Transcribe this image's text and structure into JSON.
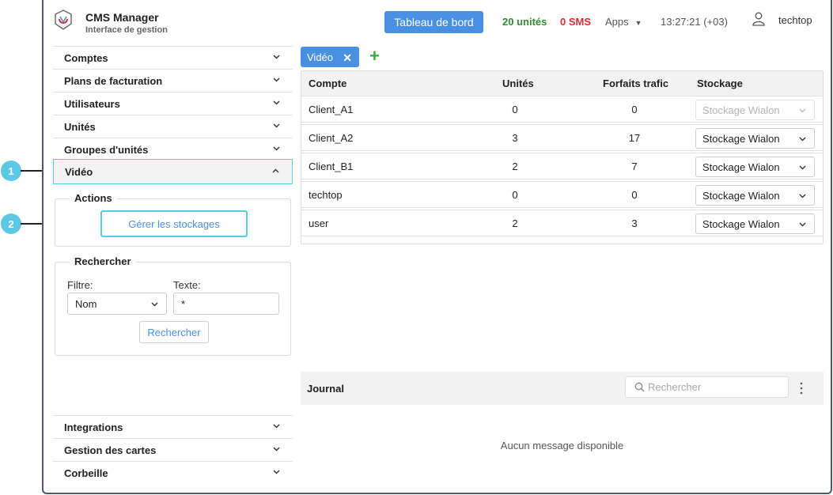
{
  "header": {
    "title": "CMS Manager",
    "subtitle": "Interface de gestion",
    "dashboard_button": "Tableau de bord",
    "units_count": "20 unités",
    "sms_count": "0 SMS",
    "apps_menu": "Apps",
    "clock": "13:27:21 (+03)",
    "username": "techtop"
  },
  "sidebar": {
    "items": [
      {
        "label": "Comptes"
      },
      {
        "label": "Plans de facturation"
      },
      {
        "label": "Utilisateurs"
      },
      {
        "label": "Unités"
      },
      {
        "label": "Groupes d'unités"
      },
      {
        "label": "Vidéo"
      }
    ],
    "bottom_items": [
      {
        "label": "Integrations"
      },
      {
        "label": "Gestion des cartes"
      },
      {
        "label": "Corbeille"
      }
    ],
    "actions": {
      "legend": "Actions",
      "manage_storage_button": "Gérer les stockages"
    },
    "search": {
      "legend": "Rechercher",
      "filter_label": "Filtre:",
      "filter_value": "Nom",
      "text_label": "Texte:",
      "text_value": "*",
      "button": "Rechercher"
    }
  },
  "main": {
    "tab_label": "Vidéo",
    "table": {
      "headers": [
        "Compte",
        "Unités",
        "Forfaits trafic",
        "Stockage"
      ],
      "rows": [
        {
          "account": "Client_A1",
          "units": "0",
          "traffic": "0",
          "storage": "Stockage Wialon",
          "disabled": true
        },
        {
          "account": "Client_A2",
          "units": "3",
          "traffic": "17",
          "storage": "Stockage Wialon",
          "disabled": false
        },
        {
          "account": "Client_B1",
          "units": "2",
          "traffic": "7",
          "storage": "Stockage Wialon",
          "disabled": false
        },
        {
          "account": "techtop",
          "units": "0",
          "traffic": "0",
          "storage": "Stockage Wialon",
          "disabled": false
        },
        {
          "account": "user",
          "units": "2",
          "traffic": "3",
          "storage": "Stockage Wialon",
          "disabled": false
        }
      ]
    },
    "journal": {
      "title": "Journal",
      "search_placeholder": "Rechercher",
      "empty_message": "Aucun message disponible"
    }
  },
  "callouts": [
    "1",
    "2"
  ],
  "colors": {
    "accent_blue": "#4a90e2",
    "highlight_cyan": "#5cc8e6",
    "units_green": "#2e8b2e",
    "sms_red": "#d32f2f",
    "add_green": "#3caa3c"
  }
}
